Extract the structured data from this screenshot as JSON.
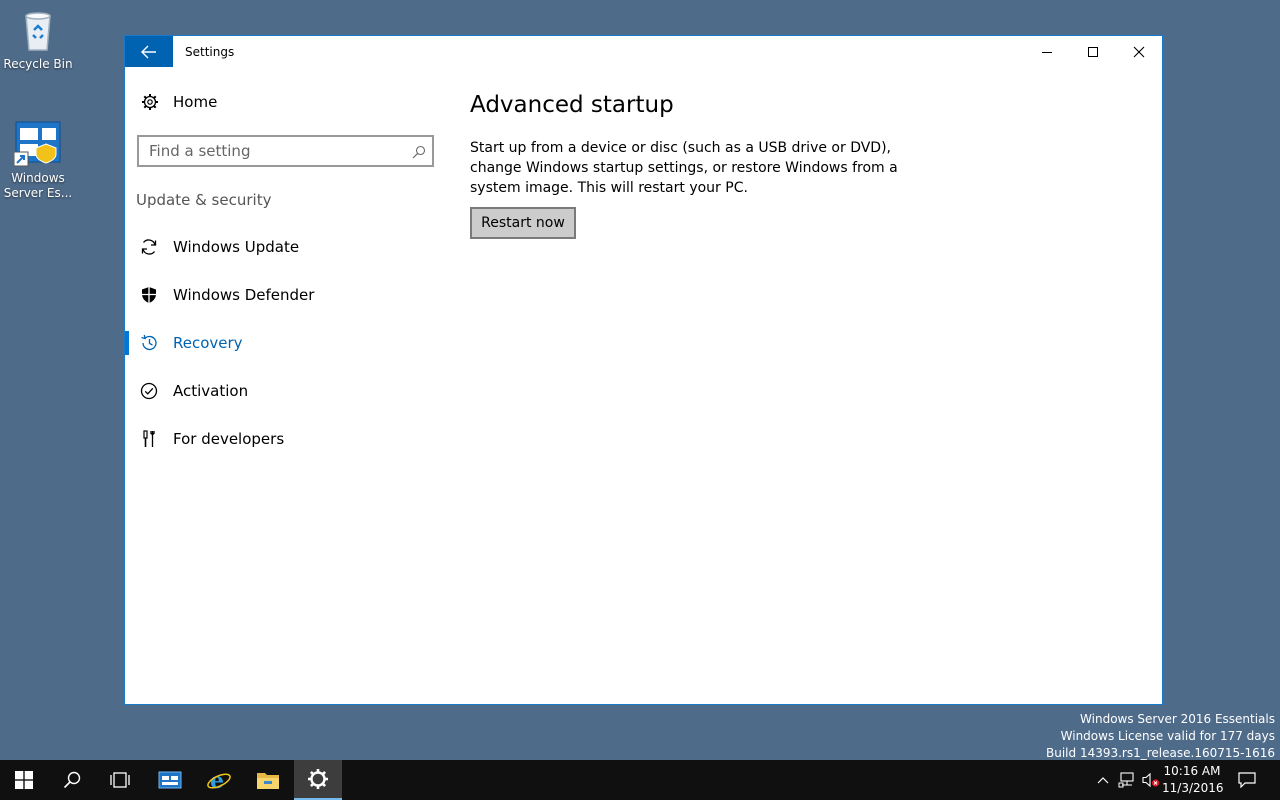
{
  "desktop": {
    "icons": [
      {
        "label": "Recycle Bin"
      },
      {
        "label": "Windows Server Es..."
      }
    ],
    "watermark": [
      "Windows Server 2016 Essentials",
      "Windows License valid for 177 days",
      "Build 14393.rs1_release.160715-1616"
    ]
  },
  "window": {
    "title": "Settings"
  },
  "sidebar": {
    "home_label": "Home",
    "search": {
      "placeholder": "Find a setting",
      "value": ""
    },
    "section_label": "Update & security",
    "items": [
      {
        "label": "Windows Update",
        "icon": "sync-icon",
        "selected": false
      },
      {
        "label": "Windows Defender",
        "icon": "shield-icon",
        "selected": false
      },
      {
        "label": "Recovery",
        "icon": "history-icon",
        "selected": true
      },
      {
        "label": "Activation",
        "icon": "checkmark-circle-icon",
        "selected": false
      },
      {
        "label": "For developers",
        "icon": "developer-tools-icon",
        "selected": false
      }
    ]
  },
  "main": {
    "heading": "Advanced startup",
    "description": "Start up from a device or disc (such as a USB drive or DVD), change Windows startup settings, or restore Windows from a system image. This will restart your PC.",
    "button_label": "Restart now"
  },
  "taskbar": {
    "clock_time": "10:16 AM",
    "clock_date": "11/3/2016"
  },
  "colors": {
    "accent": "#0063b1",
    "desktop": "#4f6b8a",
    "taskbar": "#101010"
  }
}
